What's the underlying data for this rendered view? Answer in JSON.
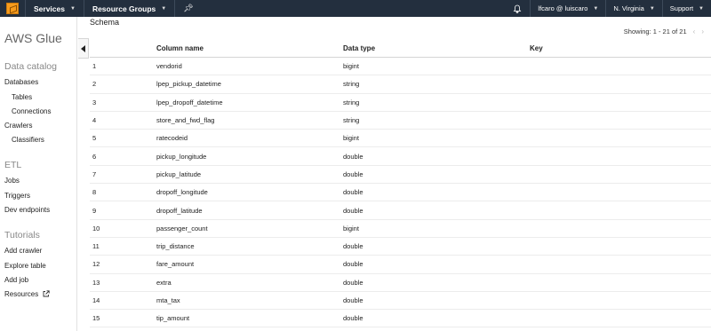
{
  "topnav": {
    "services_label": "Services",
    "resource_groups_label": "Resource Groups",
    "user_label": "lfcaro @ luiscaro",
    "region_label": "N. Virginia",
    "support_label": "Support"
  },
  "sidebar": {
    "service_title": "AWS Glue",
    "data_catalog_title": "Data catalog",
    "databases": "Databases",
    "tables": "Tables",
    "connections": "Connections",
    "crawlers": "Crawlers",
    "classifiers": "Classifiers",
    "etl_title": "ETL",
    "jobs": "Jobs",
    "triggers": "Triggers",
    "dev_endpoints": "Dev endpoints",
    "tutorials_title": "Tutorials",
    "add_crawler": "Add crawler",
    "explore_table": "Explore table",
    "add_job": "Add job",
    "resources": "Resources"
  },
  "main": {
    "schema_title": "Schema",
    "pager_text": "Showing: 1 - 21 of 21",
    "columns": [
      "Column name",
      "Data type",
      "Key"
    ],
    "rows": [
      {
        "num": "1",
        "name": "vendorid",
        "type": "bigint",
        "key": ""
      },
      {
        "num": "2",
        "name": "lpep_pickup_datetime",
        "type": "string",
        "key": ""
      },
      {
        "num": "3",
        "name": "lpep_dropoff_datetime",
        "type": "string",
        "key": ""
      },
      {
        "num": "4",
        "name": "store_and_fwd_flag",
        "type": "string",
        "key": ""
      },
      {
        "num": "5",
        "name": "ratecodeid",
        "type": "bigint",
        "key": ""
      },
      {
        "num": "6",
        "name": "pickup_longitude",
        "type": "double",
        "key": ""
      },
      {
        "num": "7",
        "name": "pickup_latitude",
        "type": "double",
        "key": ""
      },
      {
        "num": "8",
        "name": "dropoff_longitude",
        "type": "double",
        "key": ""
      },
      {
        "num": "9",
        "name": "dropoff_latitude",
        "type": "double",
        "key": ""
      },
      {
        "num": "10",
        "name": "passenger_count",
        "type": "bigint",
        "key": ""
      },
      {
        "num": "11",
        "name": "trip_distance",
        "type": "double",
        "key": ""
      },
      {
        "num": "12",
        "name": "fare_amount",
        "type": "double",
        "key": ""
      },
      {
        "num": "13",
        "name": "extra",
        "type": "double",
        "key": ""
      },
      {
        "num": "14",
        "name": "mta_tax",
        "type": "double",
        "key": ""
      },
      {
        "num": "15",
        "name": "tip_amount",
        "type": "double",
        "key": ""
      }
    ]
  },
  "colors": {
    "topbar_bg": "#232f3e",
    "logo_orange": "#f79c1d"
  },
  "icons": [
    "aws-logo-icon",
    "pin-icon",
    "bell-icon",
    "external-link-icon",
    "collapse-arrow-icon",
    "prev-page-icon",
    "next-page-icon"
  ]
}
